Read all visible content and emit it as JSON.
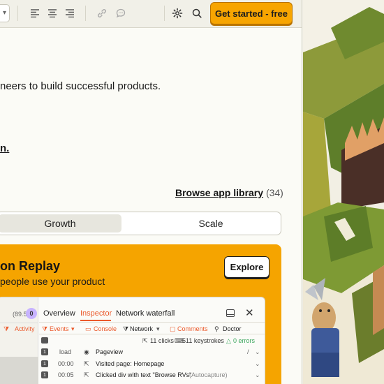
{
  "toolbar": {
    "cta_label": "Get started - free",
    "icons": [
      "chevron-down-icon",
      "align-left-icon",
      "align-center-icon",
      "align-right-icon",
      "link-icon",
      "comment-icon",
      "gear-icon",
      "search-icon"
    ]
  },
  "content": {
    "tagline": "neers to build successful products.",
    "link_fragment": "n.",
    "browse_label": "Browse app library",
    "browse_count": "(34)"
  },
  "tabs": [
    {
      "label": "Growth",
      "active": true
    },
    {
      "label": "Scale",
      "active": false
    }
  ],
  "card": {
    "title": "on Replay",
    "subtitle": "people use your product",
    "explore_label": "Explore"
  },
  "inspector": {
    "left": {
      "percent": "(89.5%)",
      "badge": "0",
      "activity_label": "Activity"
    },
    "tabs": [
      "Overview",
      "Inspector",
      "Network waterfall"
    ],
    "active_tab": "Inspector",
    "filters": [
      "Events",
      "Console",
      "Network",
      "Comments",
      "Doctor"
    ],
    "stats": {
      "clicks": "11 clicks",
      "keystrokes": "511 keystrokes",
      "errors": "0 errors"
    },
    "rows": [
      {
        "badge": "1",
        "time": "load",
        "text": "Pageview",
        "extra": ""
      },
      {
        "badge": "1",
        "time": "00:00",
        "text": "Visited page: Homepage",
        "extra": ""
      },
      {
        "badge": "1",
        "time": "00:05",
        "text": "Clicked div with text \"Browse RVs\"",
        "extra": "(Autocapture)"
      }
    ]
  },
  "colors": {
    "accent": "#f7a501",
    "card": "#f5a400",
    "inspector_red": "#eb5a2c",
    "green": "#3aa55c",
    "badge_purple": "#c7b3ff"
  }
}
